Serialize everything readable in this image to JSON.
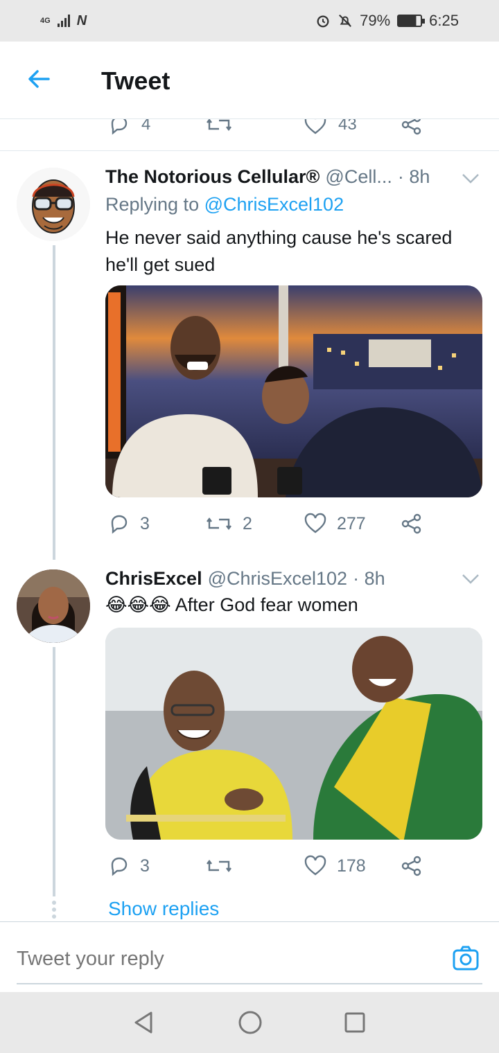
{
  "status_bar": {
    "network": "4G",
    "battery": "79%",
    "time": "6:25",
    "icons": [
      "signal-icon",
      "n-app-icon",
      "alarm-icon",
      "mute-icon",
      "battery-icon"
    ]
  },
  "header": {
    "title": "Tweet",
    "back_icon": "arrow-left-icon"
  },
  "previous_tweet_actions": {
    "replies": "4",
    "likes": "43"
  },
  "tweets": [
    {
      "name": "The Notorious Cellular®",
      "handle": "@Cell...",
      "time": "· 8h",
      "replying_prefix": "Replying to",
      "replying_to": "@ChrisExcel102",
      "text": "He never said anything cause he's scared he'll get sued",
      "replies": "3",
      "retweets": "2",
      "likes": "277"
    },
    {
      "name": "ChrisExcel",
      "handle": "@ChrisExcel102",
      "time": "· 8h",
      "emojis": "😂😂😂",
      "text": "After God fear women",
      "replies": "3",
      "retweets": "",
      "likes": "178"
    }
  ],
  "show_replies": "Show replies",
  "compose": {
    "placeholder": "Tweet your reply"
  },
  "colors": {
    "accent": "#1da1f2",
    "muted": "#657786",
    "text": "#14171a"
  }
}
